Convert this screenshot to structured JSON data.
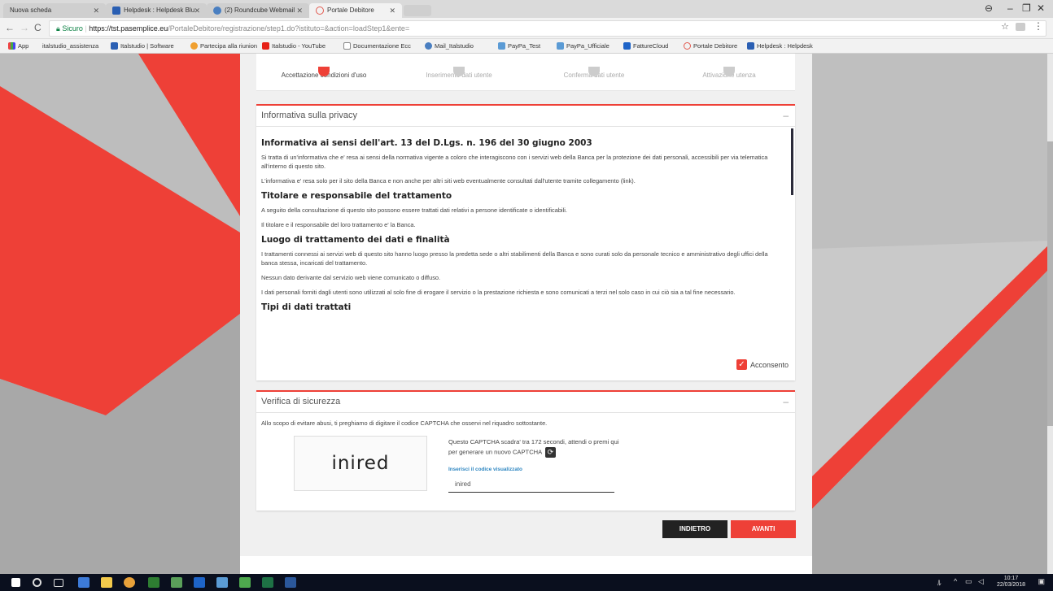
{
  "browser": {
    "tabs": [
      {
        "label": "Nuova scheda",
        "icon": "blank-page-icon",
        "state": "inactive"
      },
      {
        "label": "Helpdesk : Helpdesk Blu",
        "icon": "helpdesk-favicon",
        "state": "inactive"
      },
      {
        "label": "(2) Roundcube Webmail",
        "icon": "roundcube-favicon",
        "state": "inactive"
      },
      {
        "label": "Portale Debitore",
        "icon": "globe-icon",
        "state": "active"
      }
    ],
    "window_controls": {
      "minimize": "–",
      "maximize": "❐",
      "close": "✕"
    },
    "profile_icon": "account-circle-icon",
    "address": {
      "secure_label": "Sicuro",
      "url_host": "https://tst.pasemplice.eu",
      "url_path": "/PortaleDebitore/registrazione/step1.do?istituto=&action=loadStep1&ente="
    },
    "bookmarks": [
      "App",
      "italstudio_assistenza",
      "Italstudio | Software",
      "Partecipa alla riunion",
      "Italstudio - YouTube",
      "Documentazione Ecc",
      "Mail_Italstudio",
      "PayPa_Test",
      "PayPa_Ufficiale",
      "FattureCloud",
      "Portale Debitore",
      "Helpdesk : Helpdesk"
    ]
  },
  "stepper": {
    "steps": [
      {
        "label": "Accettazione condizioni d'uso",
        "current": true
      },
      {
        "label": "Inserimento dati utente",
        "current": false
      },
      {
        "label": "Conferma dati utente",
        "current": false
      },
      {
        "label": "Attivazione utenza",
        "current": false
      }
    ]
  },
  "privacy": {
    "title": "Informativa sulla privacy",
    "collapse": "–",
    "heading1": "Informativa ai sensi dell'art. 13 del D.Lgs. n. 196 del 30 giugno 2003",
    "p1": "Si tratta di un'informativa che e' resa ai sensi della normativa vigente a coloro che interagiscono con i servizi web della Banca per la protezione dei dati personali, accessibili per via telematica all'interno di questo sito.",
    "p2": "L'informativa e' resa solo per il sito della Banca e non anche per altri siti web eventualmente consultati dall'utente tramite collegamento (link).",
    "heading2": "Titolare e responsabile del trattamento",
    "p3": "A seguito della consultazione di questo sito possono essere trattati dati relativi a persone identificate o identificabili.",
    "p4": "Il titolare e il responsabile del loro trattamento e' la Banca.",
    "heading3": "Luogo di trattamento dei dati e finalità",
    "p5": "I trattamenti connessi ai servizi web di questo sito hanno luogo presso la predetta sede o altri stabilimenti della Banca e sono curati solo da personale tecnico e amministrativo degli uffici della banca stessa, incaricati del trattamento.",
    "p6": "Nessun dato derivante dal servizio web viene comunicato o diffuso.",
    "p7": "I dati personali forniti dagli utenti sono utilizzati al solo fine di erogare il servizio o la prestazione richiesta e sono comunicati a terzi nel solo caso in cui ciò sia a tal fine necessario.",
    "heading4": "Tipi di dati trattati",
    "consent_label": "Acconsento",
    "consent_checked": true
  },
  "security": {
    "title": "Verifica di sicurezza",
    "collapse": "–",
    "intro": "Allo scopo di evitare abusi, ti preghiamo di digitare il codice CAPTCHA che osservi nel riquadro sottostante.",
    "captcha_image_text": "inired",
    "expiry_text": "Questo CAPTCHA scadra' tra 172 secondi, attendi o premi qui per generare un nuovo CAPTCHA",
    "code_label": "Inserisci il codice visualizzato",
    "code_value": "inired"
  },
  "actions": {
    "back": "INDIETRO",
    "next": "AVANTI"
  },
  "taskbar": {
    "time": "10:17",
    "date": "22/03/2018"
  },
  "colors": {
    "accent": "#ee4037",
    "dark": "#222222"
  }
}
